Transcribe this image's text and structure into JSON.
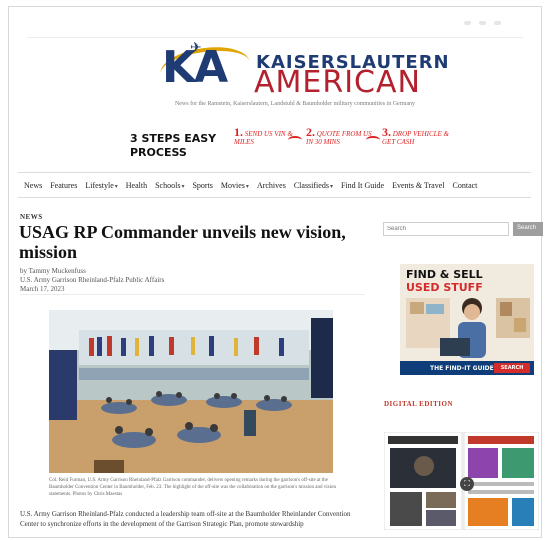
{
  "site": {
    "logo_top": "KAISERSLAUTERN",
    "logo_bottom": "AMERICAN",
    "logo_mark": "KA",
    "tagline": "News for the Ramstein, Kaiserslautern, Landstuhl & Baumholder military communities in Germany"
  },
  "ad_banner": {
    "title": "3 STEPS EASY PROCESS",
    "steps": [
      {
        "num": "1.",
        "text": "SEND US VIN & MILES"
      },
      {
        "num": "2.",
        "text": "QUOTE FROM US IN 30 MINS"
      },
      {
        "num": "3.",
        "text": "DROP VEHICLE & GET CASH"
      }
    ]
  },
  "nav": [
    {
      "label": "News",
      "dropdown": false
    },
    {
      "label": "Features",
      "dropdown": false
    },
    {
      "label": "Lifestyle",
      "dropdown": true
    },
    {
      "label": "Health",
      "dropdown": false
    },
    {
      "label": "Schools",
      "dropdown": true
    },
    {
      "label": "Sports",
      "dropdown": false
    },
    {
      "label": "Movies",
      "dropdown": true
    },
    {
      "label": "Archives",
      "dropdown": false
    },
    {
      "label": "Classifieds",
      "dropdown": true
    },
    {
      "label": "Find It Guide",
      "dropdown": false
    },
    {
      "label": "Events & Travel",
      "dropdown": false
    },
    {
      "label": "Contact",
      "dropdown": false
    }
  ],
  "article": {
    "category": "NEWS",
    "headline": "USAG RP Commander unveils new vision, mission",
    "author": "by Tammy Muckenfuss",
    "org": "U.S. Army Garrison Rheinland-Pfalz Public Affairs",
    "date": "March 17, 2023",
    "caption": "Col. Reid Furman, U.S. Army Garrison Rheinland-Pfalz Garrison commander, delivers opening remarks during the garrison's off-site at the Baumholder Convention Center in Baumholder, Feb. 23. The highlight of the off-site was the collaboration on the garrison's mission and vision statements. Photos by Chris Maestas",
    "body": "U.S. Army Garrison Rheinland-Pfalz conducted a leadership team off-site at the Baumholder Rheinlander Convention Center to synchronize efforts in the development of the Garrison Strategic Plan, promote stewardship"
  },
  "sidebar": {
    "search_placeholder": "Search",
    "search_button": "Search",
    "ad_head1": "FIND & SELL",
    "ad_head2": "USED STUFF",
    "ad_find": "THE FIND-IT GUIDE",
    "ad_button": "SEARCH NOW",
    "digital_edition_label": "DIGITAL EDITION"
  },
  "colors": {
    "brand_blue": "#1f3b73",
    "brand_red": "#b3202e",
    "accent_red": "#c0392b"
  }
}
